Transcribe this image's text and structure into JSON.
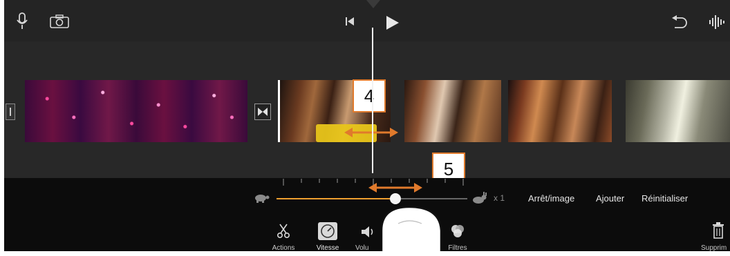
{
  "toolbar_top": {
    "mic_icon": "microphone-icon",
    "camera_icon": "camera-icon",
    "skip_back_icon": "skip-to-start-icon",
    "play_icon": "play-icon",
    "undo_icon": "undo-icon",
    "waveform_icon": "audio-waveform-icon"
  },
  "callouts": {
    "step4": "4",
    "step5": "5"
  },
  "speed_bar": {
    "slow_icon": "turtle-icon",
    "fast_icon": "rabbit-icon",
    "multiplier": "x 1",
    "freeze_label": "Arrêt/image",
    "add_label": "Ajouter",
    "reset_label": "Réinitialiser",
    "slider_position": 0.63
  },
  "bottom_tools": {
    "actions": "Actions",
    "speed": "Vitesse",
    "volume": "Volu",
    "filters": "Filtres",
    "delete": "Supprim"
  },
  "colors": {
    "accent_orange": "#e07a2c",
    "selection_yellow": "#e8c51a",
    "slider_track": "#f0a030"
  }
}
